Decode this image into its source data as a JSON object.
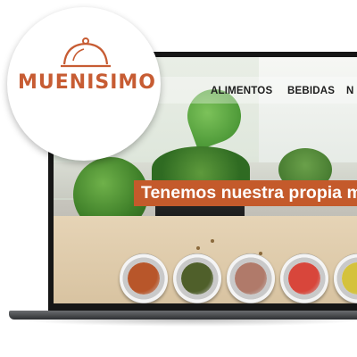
{
  "logo": {
    "text": "MUENISIMO",
    "color": "#c75c33",
    "icon": "serving-cloche-icon"
  },
  "nav": {
    "items": [
      "ALIMENTOS",
      "BEBIDAS",
      "N"
    ]
  },
  "hero": {
    "banner_text": "Tenemos nuestra propia m",
    "banner_color": "#c45a2b"
  },
  "jars": {
    "fill_colors": [
      "#b8562a",
      "#4f5f2a",
      "#b07a6a",
      "#d8463b",
      "#d4c23c"
    ]
  }
}
